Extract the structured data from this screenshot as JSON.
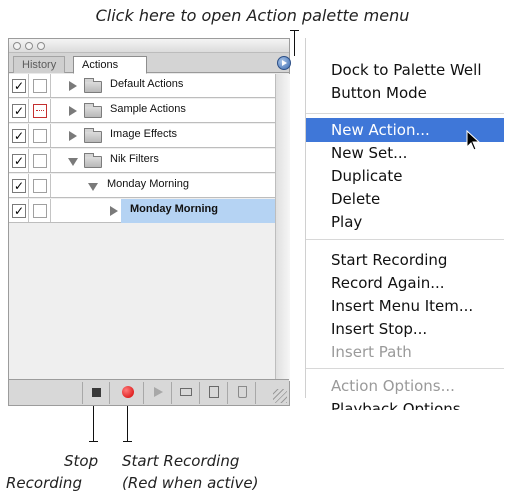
{
  "callouts": {
    "top": "Click here to open Action palette menu",
    "stop_line1": "Stop",
    "stop_line2": "Recording",
    "start_line1": "Start Recording",
    "start_line2": "(Red when active)"
  },
  "palette": {
    "tabs": [
      "History",
      "Actions"
    ],
    "rows": [
      {
        "label": "Default Actions",
        "checked": "✓",
        "dialog": false,
        "expanded": false
      },
      {
        "label": "Sample Actions",
        "checked": "✓",
        "dialog": true,
        "expanded": false
      },
      {
        "label": "Image Effects",
        "checked": "✓",
        "dialog": false,
        "expanded": false
      },
      {
        "label": "Nik Filters",
        "checked": "✓",
        "dialog": false,
        "expanded": true
      },
      {
        "label": "Monday Morning",
        "checked": "✓",
        "dialog": false,
        "expanded": true
      },
      {
        "label": "Monday Morning",
        "checked": "✓",
        "dialog": false,
        "expanded": false,
        "selected": true
      }
    ],
    "recording_state": "recording",
    "recording_color": "#d40000"
  },
  "menu": {
    "items": [
      {
        "label": "Dock to Palette Well",
        "state": "normal"
      },
      {
        "label": "Button Mode",
        "state": "normal"
      },
      {
        "label": "New Action...",
        "state": "active"
      },
      {
        "label": "New Set...",
        "state": "normal"
      },
      {
        "label": "Duplicate",
        "state": "normal"
      },
      {
        "label": "Delete",
        "state": "normal"
      },
      {
        "label": "Play",
        "state": "normal"
      },
      {
        "label": "Start Recording",
        "state": "normal"
      },
      {
        "label": "Record Again...",
        "state": "normal"
      },
      {
        "label": "Insert Menu Item...",
        "state": "normal"
      },
      {
        "label": "Insert Stop...",
        "state": "normal"
      },
      {
        "label": "Insert Path",
        "state": "disabled"
      },
      {
        "label": "Action Options...",
        "state": "disabled"
      },
      {
        "label": "Playback Options",
        "state": "normal"
      }
    ],
    "highlight_color": "#3f77d8"
  }
}
